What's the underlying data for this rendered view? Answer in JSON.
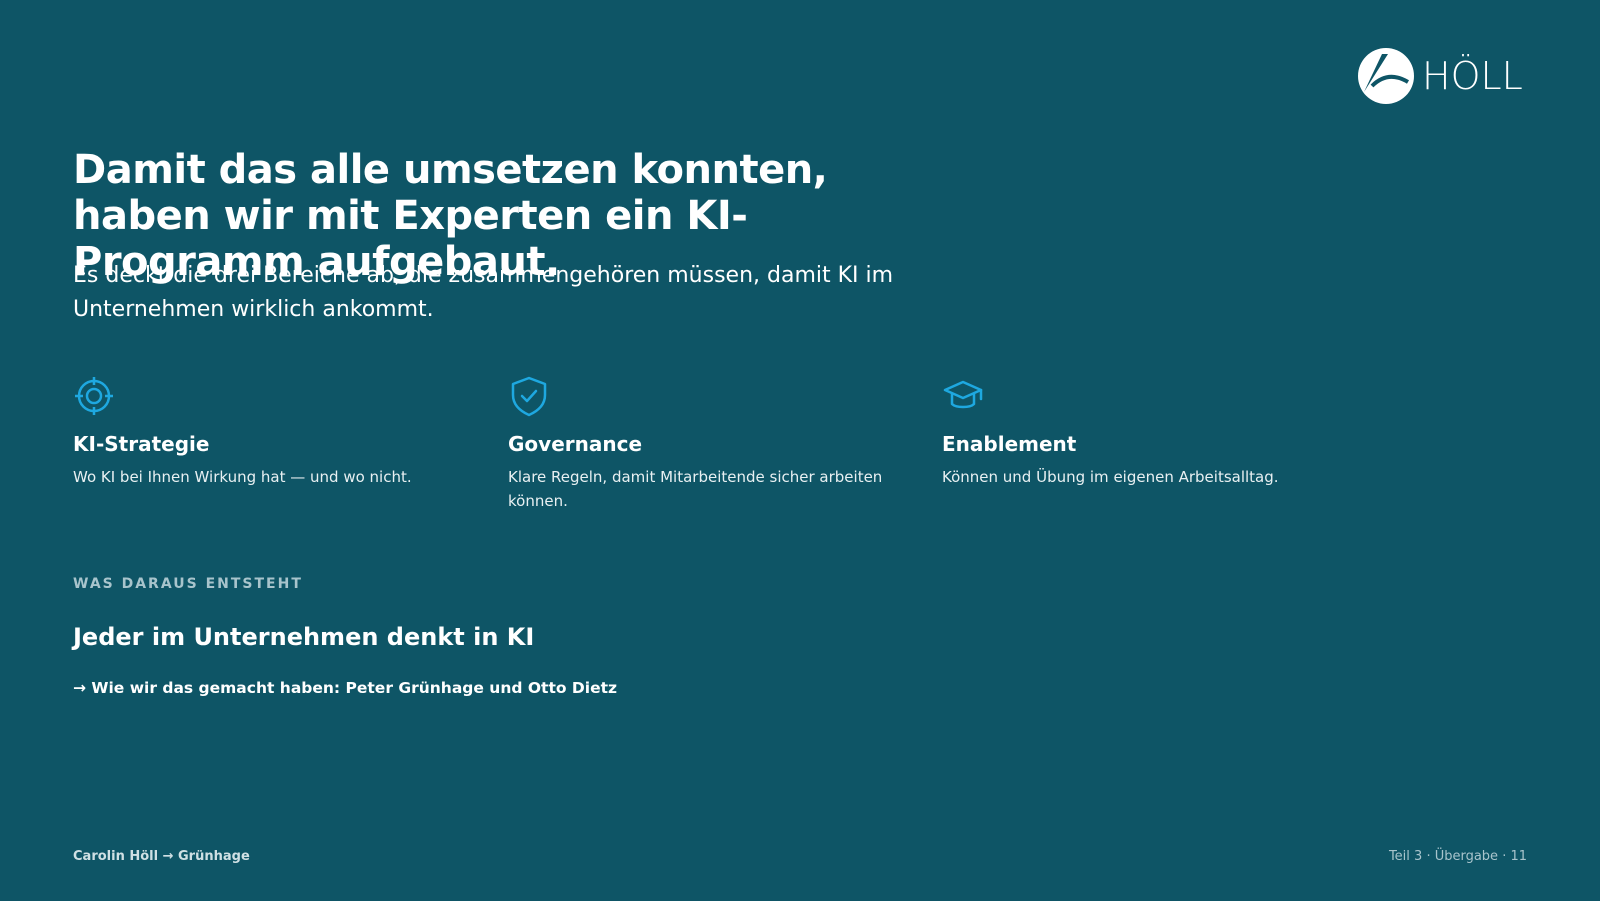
{
  "brand": {
    "name": "HÖLL",
    "logo_icon": "hoell-logo-icon"
  },
  "slide": {
    "title": "Damit das alle umsetzen konnten, haben wir mit Experten ein KI-Programm aufgebaut.",
    "subtitle": "Es deckt die drei Bereiche ab, die zusammengehören müssen, damit KI im Unternehmen wirklich ankommt.",
    "pillars": [
      {
        "icon": "target-icon",
        "title": "KI-Strategie",
        "text": "Wo KI bei Ihnen Wirkung hat — und wo nicht."
      },
      {
        "icon": "shield-check-icon",
        "title": "Governance",
        "text": "Klare Regeln, damit Mitarbeitende sicher arbeiten können."
      },
      {
        "icon": "graduation-cap-icon",
        "title": "Enablement",
        "text": "Können und Übung im eigenen Arbeitsalltag."
      }
    ],
    "eyebrow": "WAS DARAUS ENTSTEHT",
    "outcome": "Jeder im Unternehmen denkt in KI",
    "link": "→ Wie wir das gemacht haben: Peter Grünhage und Otto Dietz"
  },
  "footer": {
    "left": "Carolin Höll → Grünhage",
    "right": "Teil 3 · Übergabe · 11"
  },
  "colors": {
    "background": "#0e5566",
    "accent": "#1ea8e0",
    "text": "#ffffff"
  }
}
